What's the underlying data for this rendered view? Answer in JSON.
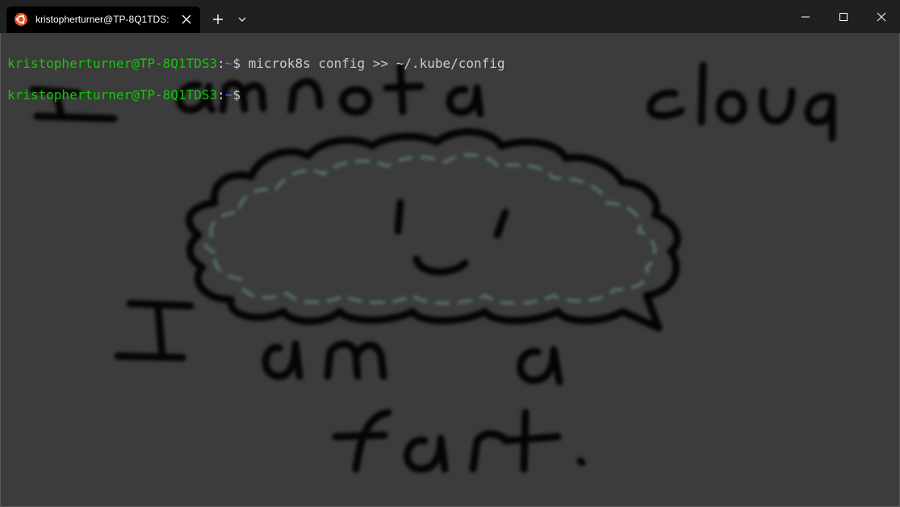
{
  "tab": {
    "title": "kristopherturner@TP-8Q1TDS:",
    "icon": "ubuntu-icon",
    "close_icon": "close-icon"
  },
  "tabbar": {
    "new_tab_icon": "plus-icon",
    "dropdown_icon": "chevron-down-icon"
  },
  "window_controls": [
    "minimize-icon",
    "maximize-icon",
    "close-icon"
  ],
  "terminal": {
    "lines": [
      {
        "user": "kristopherturner@TP-8Q1TDS3",
        "sep": ":",
        "path": "~",
        "prompt": "$ ",
        "command": "microk8s config >> ~/.kube/config"
      },
      {
        "user": "kristopherturner@TP-8Q1TDS3",
        "sep": ":",
        "path": "~",
        "prompt": "$ ",
        "command": ""
      }
    ]
  },
  "background_image": {
    "lines": [
      "I am not a cloud",
      "I am a",
      "fart."
    ]
  },
  "colors": {
    "titlebar": "#202020",
    "tab_active": "#000000",
    "terminal_bg": "#3c3c3c",
    "prompt_user": "#16c60c",
    "prompt_path": "#3b78ff",
    "text": "#cccccc",
    "ubuntu_orange": "#e95420"
  }
}
